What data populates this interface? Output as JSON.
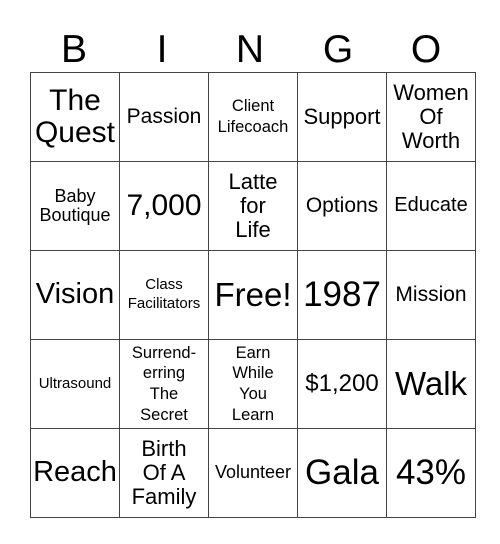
{
  "header": [
    "B",
    "I",
    "N",
    "G",
    "O"
  ],
  "rows": [
    [
      "The\nQuest",
      "Passion",
      "Client\nLifecoach",
      "Support",
      "Women\nOf\nWorth"
    ],
    [
      "Baby\nBoutique",
      "7,000",
      "Latte\nfor\nLife",
      "Options",
      "Educate"
    ],
    [
      "Vision",
      "Class\nFacilitators",
      "Free!",
      "1987",
      "Mission"
    ],
    [
      "Ultrasound",
      "Surrend-\nerring\nThe\nSecret",
      "Earn\nWhile\nYou\nLearn",
      "$1,200",
      "Walk"
    ],
    [
      "Reach",
      "Birth\nOf A\nFamily",
      "Volunteer",
      "Gala",
      "43%"
    ]
  ]
}
